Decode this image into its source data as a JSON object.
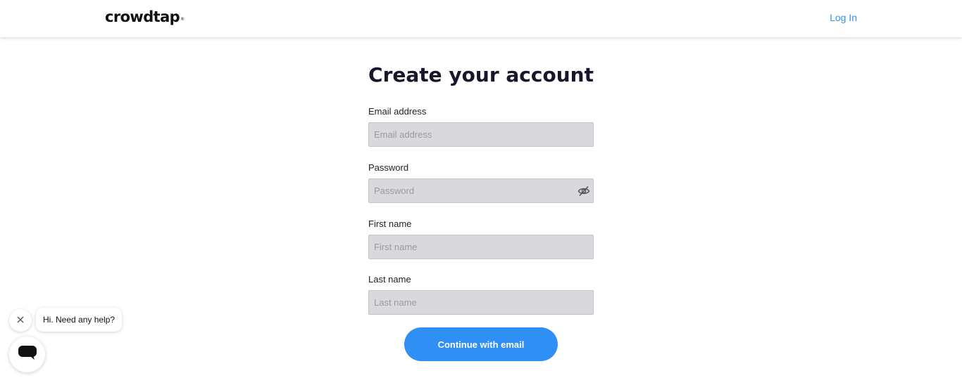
{
  "header": {
    "logo_text": "crowdtap",
    "logo_mark": "®",
    "login_label": "Log In"
  },
  "form": {
    "title": "Create your account",
    "email": {
      "label": "Email address",
      "placeholder": "Email address",
      "value": ""
    },
    "password": {
      "label": "Password",
      "placeholder": "Password",
      "value": "",
      "toggle_icon": "eye-slash-icon"
    },
    "first_name": {
      "label": "First name",
      "placeholder": "First name",
      "value": ""
    },
    "last_name": {
      "label": "Last name",
      "placeholder": "Last name",
      "value": ""
    },
    "submit_label": "Continue with email"
  },
  "chat": {
    "greeting": "Hi. Need any help?",
    "close_icon": "close-icon",
    "launcher_icon": "chat-bubble-icon"
  },
  "colors": {
    "accent": "#2f8ff5",
    "input_bg": "#d9d9dd",
    "title": "#17172b"
  }
}
